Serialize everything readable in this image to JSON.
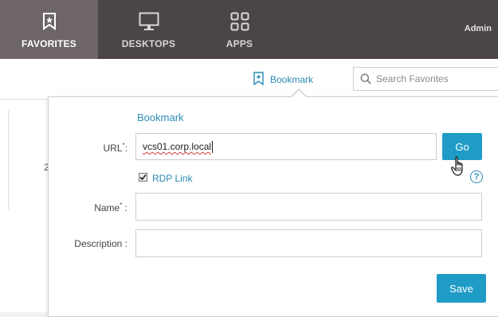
{
  "nav": {
    "items": [
      {
        "label": "FAVORITES",
        "icon": "bookmark-icon",
        "active": true
      },
      {
        "label": "DESKTOPS",
        "icon": "monitor-icon",
        "active": false
      },
      {
        "label": "APPS",
        "icon": "apps-grid-icon",
        "active": false
      }
    ],
    "user": "Admin"
  },
  "toolbar": {
    "bookmark_label": "Bookmark",
    "search_placeholder": "Search Favorites"
  },
  "page": {
    "partial_text": "2"
  },
  "dialog": {
    "title": "Bookmark",
    "url_label": "URL",
    "url_required": "*",
    "url_suffix": ":",
    "url_value": "vcs01.corp.local",
    "go_label": "Go",
    "rdp_link_label": "RDP Link",
    "rdp_link_checked": true,
    "help_symbol": "?",
    "name_label": "Name",
    "name_required": "*",
    "name_suffix": " :",
    "name_value": "",
    "description_label": "Description :",
    "description_value": "",
    "save_label": "Save"
  },
  "colors": {
    "accent": "#1f9cc6",
    "link": "#2a8bb6",
    "nav_bg": "#4b4449",
    "nav_active_bg": "#6e6569"
  }
}
